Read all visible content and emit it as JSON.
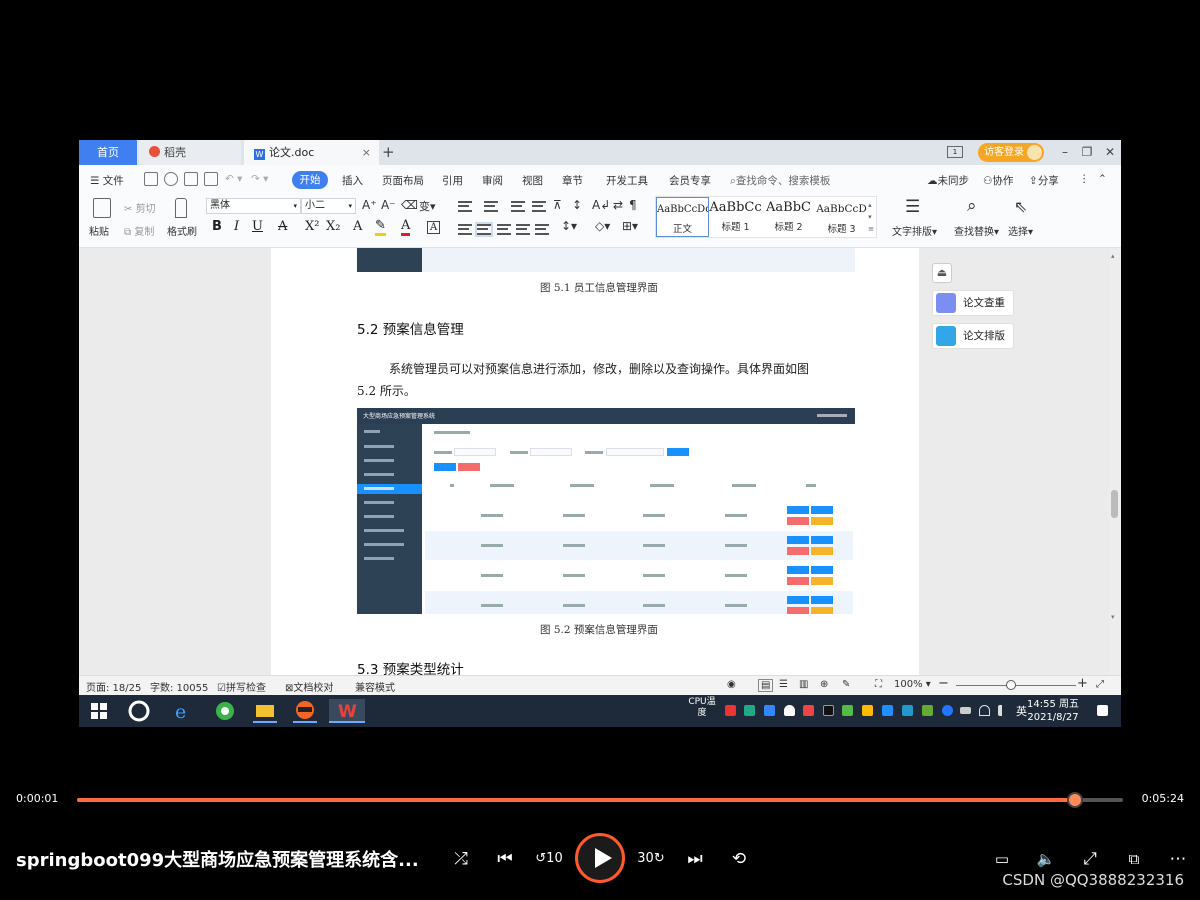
{
  "app": {
    "tabs": [
      {
        "label": "首页"
      },
      {
        "label": "稻壳"
      },
      {
        "label": "论文.doc"
      }
    ],
    "login_label": "访客登录",
    "layout_badge": "1"
  },
  "menu": {
    "file": "文件",
    "items": [
      "开始",
      "插入",
      "页面布局",
      "引用",
      "审阅",
      "视图",
      "章节",
      "开发工具",
      "会员专享"
    ],
    "search_placeholder": "查找命令、搜索模板",
    "unsync": "未同步",
    "collab": "协作",
    "share": "分享"
  },
  "ribbon": {
    "paste": "粘贴",
    "cut": "剪切",
    "copy": "复制",
    "format_painter": "格式刷",
    "font_name": "黑体",
    "font_size": "小二",
    "styles": [
      {
        "sample": "AaBbCcDd",
        "name": "正文"
      },
      {
        "sample": "AaBbCc",
        "name": "标题 1"
      },
      {
        "sample": "AaBbC",
        "name": "标题 2"
      },
      {
        "sample": "AaBbCcD",
        "name": "标题 3"
      }
    ],
    "text_layout": "文字排版",
    "find_replace": "查找替换",
    "select": "选择"
  },
  "document": {
    "caption_1": "图 5.1  员工信息管理界面",
    "heading": "5.2  预案信息管理",
    "para_line1": "系统管理员可以对预案信息进行添加，修改，删除以及查询操作。具体界面如图",
    "para_line2": "5.2 所示。",
    "caption_2": "图 5.2  预案信息管理界面",
    "next_heading": "5.3  预案类型统计",
    "embedded_title": "大型商场应急预案管理系统"
  },
  "side_panel": {
    "check": "论文查重",
    "layout": "论文排版"
  },
  "status": {
    "page": "页面: 18/25",
    "words": "字数: 10055",
    "spell": "拼写检查",
    "proof": "文档校对",
    "compat": "兼容模式",
    "zoom": "100%"
  },
  "taskbar": {
    "cpu": "CPU温度",
    "lang": "英",
    "time": "14:55 周五",
    "date": "2021/8/27"
  },
  "player": {
    "elapsed": "0:00:01",
    "total": "0:05:24",
    "progress_fraction": 0.954,
    "title": "springboot099大型商场应急预案管理系统含...",
    "watermark": "CSDN @QQ3888232316"
  },
  "colors": {
    "accent": "#3f7ff0",
    "progress": "#ff6a3d",
    "play_ring": "#ff5a2a",
    "login": "#f5a623"
  }
}
